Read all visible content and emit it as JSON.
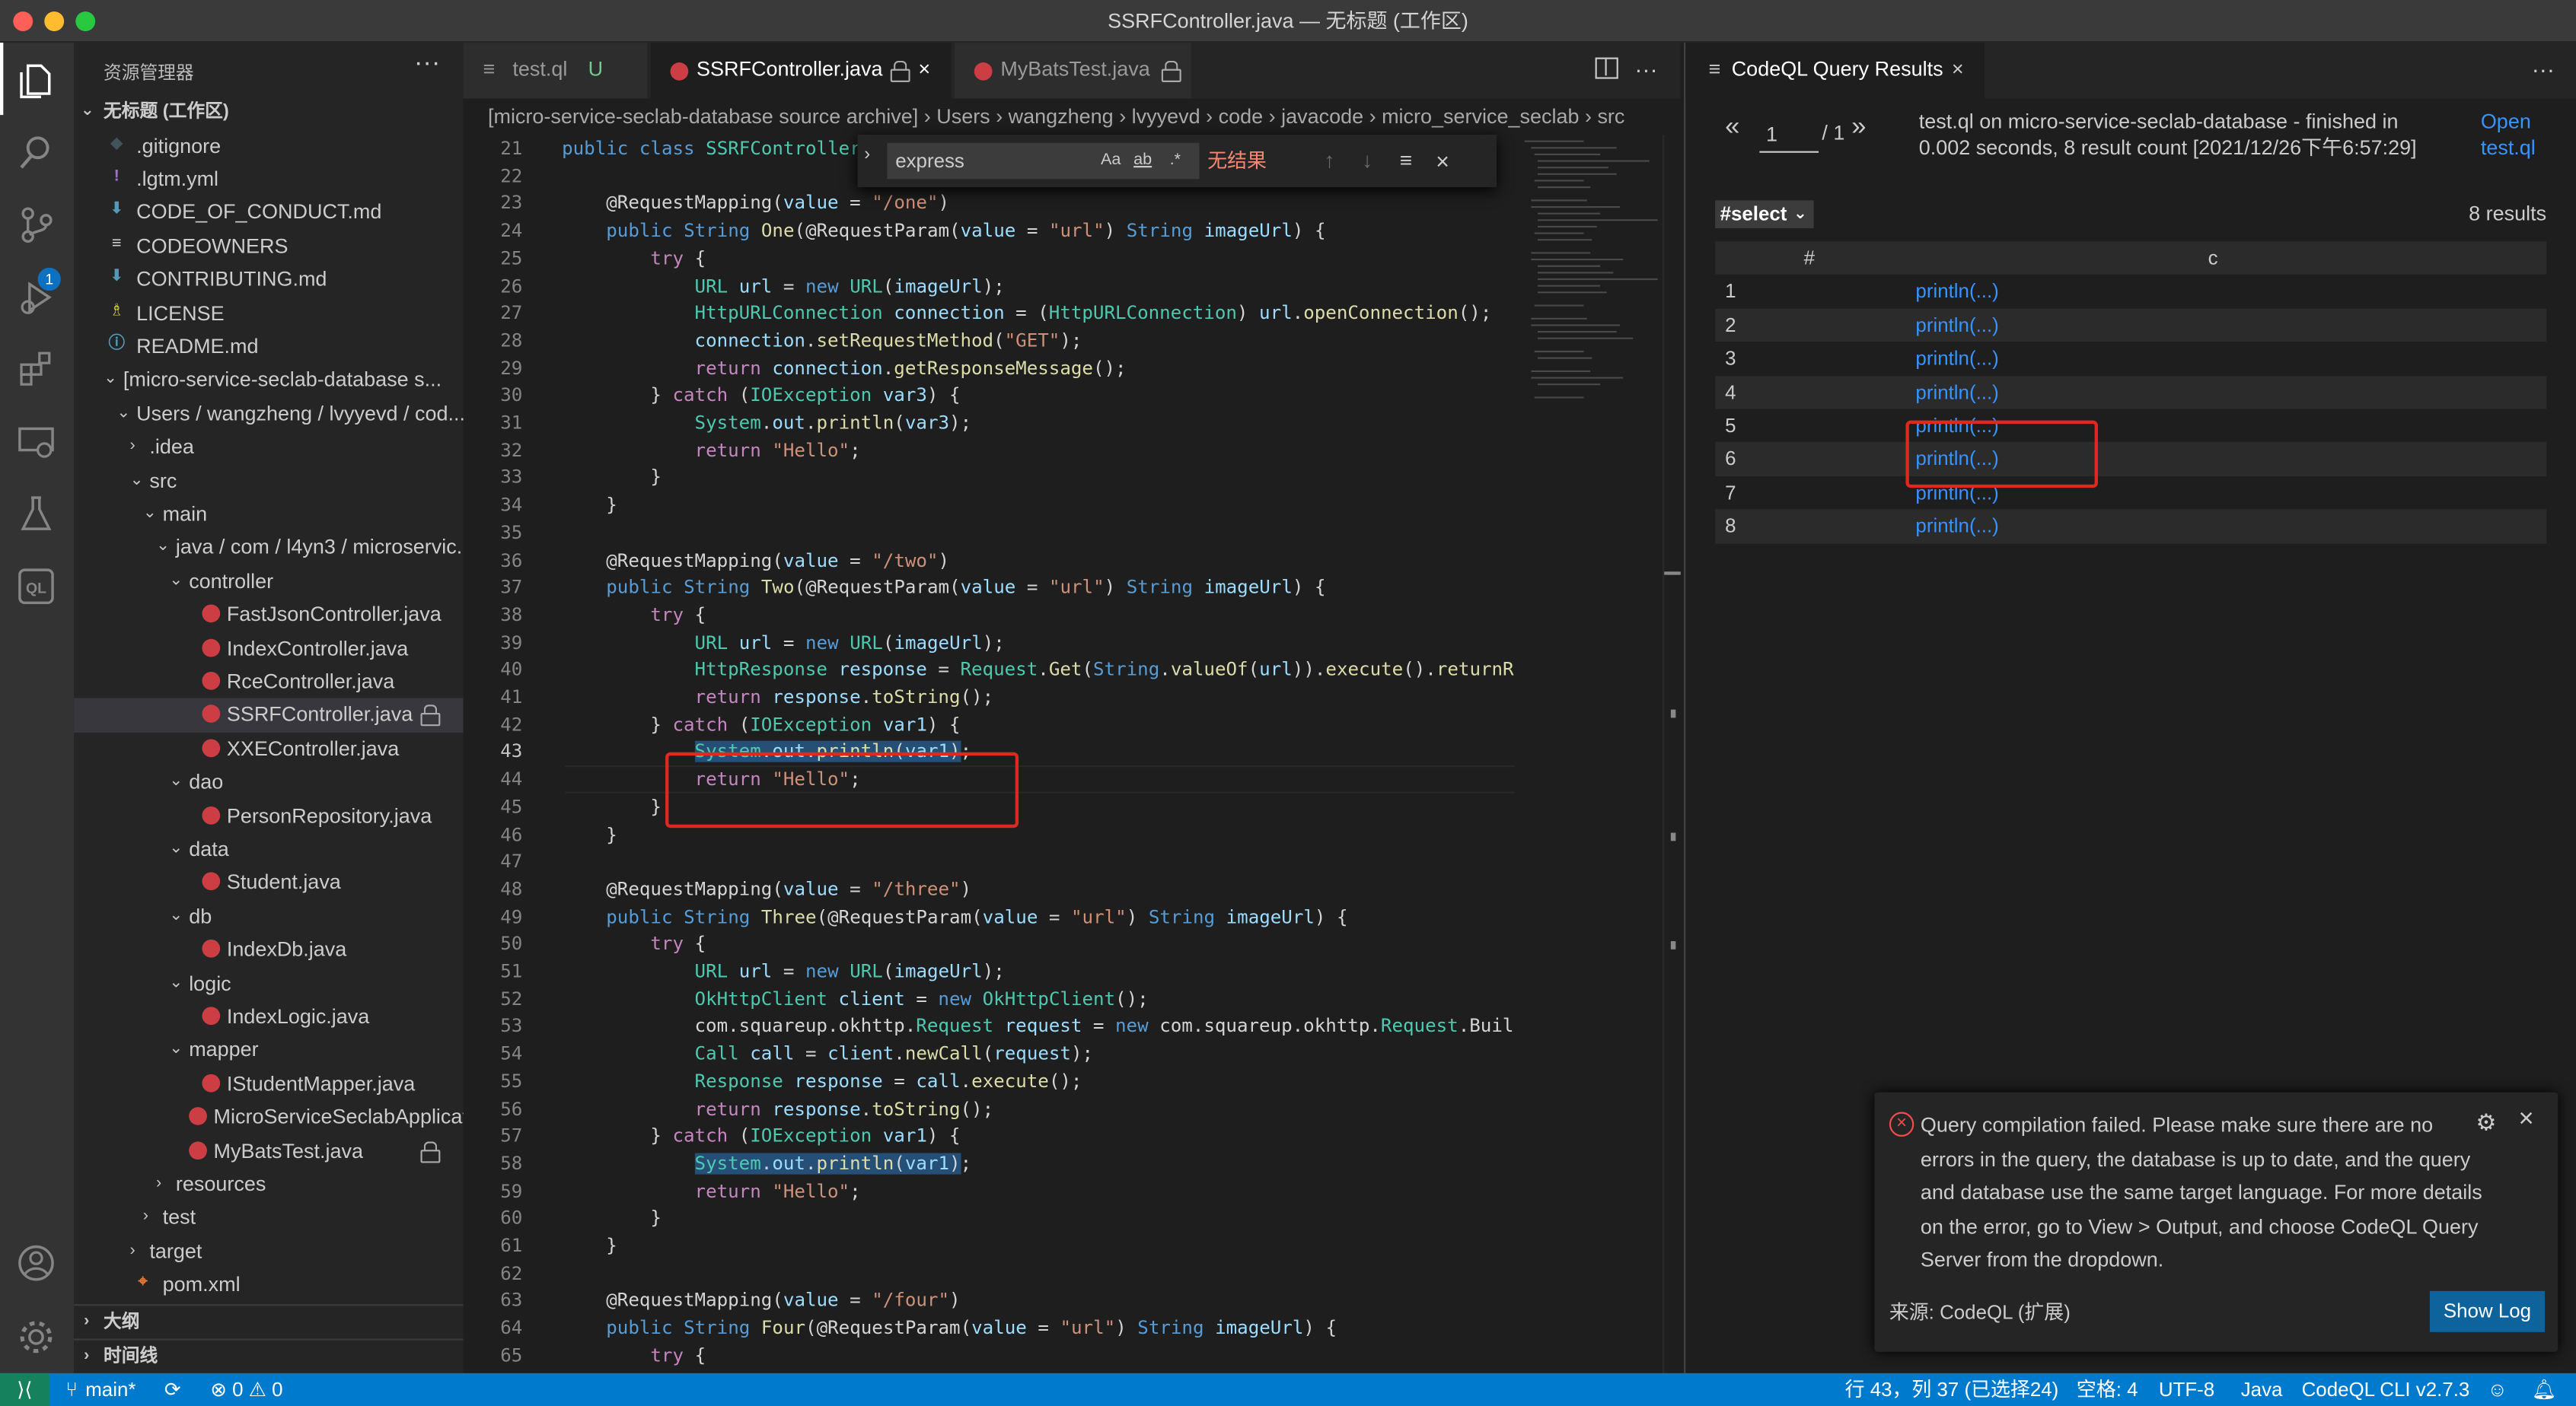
{
  "window": {
    "title": "SSRFController.java — 无标题 (工作区)"
  },
  "colors": {
    "accent": "#007acc",
    "red_box": "#e0281e",
    "java_icon": "#cc3e44",
    "link": "#3794ff"
  },
  "activity_bar": [
    "explorer-icon",
    "search-icon",
    "source-control-icon",
    "run-debug-icon",
    "extensions-icon",
    "remote-explorer-icon",
    "testing-icon",
    "codeql-icon",
    "account-icon",
    "settings-gear-icon"
  ],
  "activity_badge": "1",
  "sidebar": {
    "header": "资源管理器",
    "workspace": "无标题 (工作区)",
    "items": [
      {
        "label": ".gitignore",
        "indent": 0,
        "kind": "git"
      },
      {
        "label": ".lgtm.yml",
        "indent": 0,
        "kind": "yml"
      },
      {
        "label": "CODE_OF_CONDUCT.md",
        "indent": 0,
        "kind": "md"
      },
      {
        "label": "CODEOWNERS",
        "indent": 0,
        "kind": "txt"
      },
      {
        "label": "CONTRIBUTING.md",
        "indent": 0,
        "kind": "md"
      },
      {
        "label": "LICENSE",
        "indent": 0,
        "kind": "lic"
      },
      {
        "label": "README.md",
        "indent": 0,
        "kind": "info"
      },
      {
        "label": "[micro-service-seclab-database s...",
        "indent": 0,
        "kind": "folder-open"
      },
      {
        "label": "Users / wangzheng / lvyyevd / cod...",
        "indent": 1,
        "kind": "folder-open"
      },
      {
        "label": ".idea",
        "indent": 2,
        "kind": "folder-closed"
      },
      {
        "label": "src",
        "indent": 2,
        "kind": "folder-open"
      },
      {
        "label": "main",
        "indent": 3,
        "kind": "folder-open"
      },
      {
        "label": "java / com / l4yn3 / microservic...",
        "indent": 4,
        "kind": "folder-open"
      },
      {
        "label": "controller",
        "indent": 5,
        "kind": "folder-open"
      },
      {
        "label": "FastJsonController.java",
        "indent": 6,
        "kind": "java"
      },
      {
        "label": "IndexController.java",
        "indent": 6,
        "kind": "java"
      },
      {
        "label": "RceController.java",
        "indent": 6,
        "kind": "java"
      },
      {
        "label": "SSRFController.java",
        "indent": 6,
        "kind": "java",
        "selected": true,
        "locked": true
      },
      {
        "label": "XXEController.java",
        "indent": 6,
        "kind": "java"
      },
      {
        "label": "dao",
        "indent": 5,
        "kind": "folder-open"
      },
      {
        "label": "PersonRepository.java",
        "indent": 6,
        "kind": "java"
      },
      {
        "label": "data",
        "indent": 5,
        "kind": "folder-open"
      },
      {
        "label": "Student.java",
        "indent": 6,
        "kind": "java"
      },
      {
        "label": "db",
        "indent": 5,
        "kind": "folder-open"
      },
      {
        "label": "IndexDb.java",
        "indent": 6,
        "kind": "java"
      },
      {
        "label": "logic",
        "indent": 5,
        "kind": "folder-open"
      },
      {
        "label": "IndexLogic.java",
        "indent": 6,
        "kind": "java"
      },
      {
        "label": "mapper",
        "indent": 5,
        "kind": "folder-open"
      },
      {
        "label": "IStudentMapper.java",
        "indent": 6,
        "kind": "java"
      },
      {
        "label": "MicroServiceSeclabApplicat...",
        "indent": 5,
        "kind": "java"
      },
      {
        "label": "MyBatsTest.java",
        "indent": 5,
        "kind": "java",
        "locked": true
      },
      {
        "label": "resources",
        "indent": 4,
        "kind": "folder-closed"
      },
      {
        "label": "test",
        "indent": 3,
        "kind": "folder-closed"
      },
      {
        "label": "target",
        "indent": 2,
        "kind": "folder-closed"
      },
      {
        "label": "pom.xml",
        "indent": 2,
        "kind": "xml"
      }
    ],
    "sections": [
      "大纲",
      "时间线"
    ]
  },
  "tabs": [
    {
      "label": "test.ql",
      "status": "U",
      "active": false
    },
    {
      "label": "SSRFController.java",
      "active": true,
      "locked": true
    },
    {
      "label": "MyBatsTest.java",
      "active": false,
      "locked": true
    }
  ],
  "breadcrumb": [
    "[micro-service-seclab-database source archive]",
    "Users",
    "wangzheng",
    "lvyyevd",
    "code",
    "javacode",
    "micro_service_seclab",
    "src"
  ],
  "find": {
    "value": "express",
    "match_case": "Aa",
    "whole_word": "ab",
    "regex": ".*",
    "result": "无结果"
  },
  "code": {
    "current_line": 43,
    "lines": [
      {
        "n": 21,
        "t": "public class SSRFController {"
      },
      {
        "n": 22,
        "t": ""
      },
      {
        "n": 23,
        "t": "    @RequestMapping(value = \"/one\")"
      },
      {
        "n": 24,
        "t": "    public String One(@RequestParam(value = \"url\") String imageUrl) {"
      },
      {
        "n": 25,
        "t": "        try {"
      },
      {
        "n": 26,
        "t": "            URL url = new URL(imageUrl);"
      },
      {
        "n": 27,
        "t": "            HttpURLConnection connection = (HttpURLConnection) url.openConnection();"
      },
      {
        "n": 28,
        "t": "            connection.setRequestMethod(\"GET\");"
      },
      {
        "n": 29,
        "t": "            return connection.getResponseMessage();"
      },
      {
        "n": 30,
        "t": "        } catch (IOException var3) {"
      },
      {
        "n": 31,
        "t": "            System.out.println(var3);"
      },
      {
        "n": 32,
        "t": "            return \"Hello\";"
      },
      {
        "n": 33,
        "t": "        }"
      },
      {
        "n": 34,
        "t": "    }"
      },
      {
        "n": 35,
        "t": ""
      },
      {
        "n": 36,
        "t": "    @RequestMapping(value = \"/two\")"
      },
      {
        "n": 37,
        "t": "    public String Two(@RequestParam(value = \"url\") String imageUrl) {"
      },
      {
        "n": 38,
        "t": "        try {"
      },
      {
        "n": 39,
        "t": "            URL url = new URL(imageUrl);"
      },
      {
        "n": 40,
        "t": "            HttpResponse response = Request.Get(String.valueOf(url)).execute().returnRe"
      },
      {
        "n": 41,
        "t": "            return response.toString();"
      },
      {
        "n": 42,
        "t": "        } catch (IOException var1) {"
      },
      {
        "n": 43,
        "t": "            System.out.println(var1);"
      },
      {
        "n": 44,
        "t": "            return \"Hello\";"
      },
      {
        "n": 45,
        "t": "        }"
      },
      {
        "n": 46,
        "t": "    }"
      },
      {
        "n": 47,
        "t": ""
      },
      {
        "n": 48,
        "t": "    @RequestMapping(value = \"/three\")"
      },
      {
        "n": 49,
        "t": "    public String Three(@RequestParam(value = \"url\") String imageUrl) {"
      },
      {
        "n": 50,
        "t": "        try {"
      },
      {
        "n": 51,
        "t": "            URL url = new URL(imageUrl);"
      },
      {
        "n": 52,
        "t": "            OkHttpClient client = new OkHttpClient();"
      },
      {
        "n": 53,
        "t": "            com.squareup.okhttp.Request request = new com.squareup.okhttp.Request.Buil"
      },
      {
        "n": 54,
        "t": "            Call call = client.newCall(request);"
      },
      {
        "n": 55,
        "t": "            Response response = call.execute();"
      },
      {
        "n": 56,
        "t": "            return response.toString();"
      },
      {
        "n": 57,
        "t": "        } catch (IOException var1) {"
      },
      {
        "n": 58,
        "t": "            System.out.println(var1);"
      },
      {
        "n": 59,
        "t": "            return \"Hello\";"
      },
      {
        "n": 60,
        "t": "        }"
      },
      {
        "n": 61,
        "t": "    }"
      },
      {
        "n": 62,
        "t": ""
      },
      {
        "n": 63,
        "t": "    @RequestMapping(value = \"/four\")"
      },
      {
        "n": 64,
        "t": "    public String Four(@RequestParam(value = \"url\") String imageUrl) {"
      },
      {
        "n": 65,
        "t": "        try {"
      }
    ]
  },
  "results_panel": {
    "tab": "CodeQL Query Results",
    "page": "1",
    "page_total": "/ 1",
    "summary": "test.ql on micro-service-seclab-database - finished in 0.002 seconds, 8 result count [2021/12/26下午6:57:29]",
    "open_link": "Open test.ql",
    "select": "#select",
    "count": "8 results",
    "headers": [
      "#",
      "c"
    ],
    "rows": [
      {
        "n": "1",
        "c": "println(...)"
      },
      {
        "n": "2",
        "c": "println(...)"
      },
      {
        "n": "3",
        "c": "println(...)"
      },
      {
        "n": "4",
        "c": "println(...)"
      },
      {
        "n": "5",
        "c": "println(...)"
      },
      {
        "n": "6",
        "c": "println(...)"
      },
      {
        "n": "7",
        "c": "println(...)"
      },
      {
        "n": "8",
        "c": "println(...)"
      }
    ]
  },
  "notification": {
    "message": "Query compilation failed. Please make sure there are no errors in the query, the database is up to date, and the query and database use the same target language. For more details on the error, go to View > Output, and choose CodeQL Query Server from the dropdown.",
    "source": "来源: CodeQL (扩展)",
    "button": "Show Log"
  },
  "statusbar": {
    "branch": "main*",
    "problems": "⊗ 0 ⚠ 0",
    "position": "行 43，列 37 (已选择24)",
    "spaces": "空格: 4",
    "encoding": "UTF-8",
    "language": "Java",
    "cli": "CodeQL CLI v2.7.3"
  }
}
